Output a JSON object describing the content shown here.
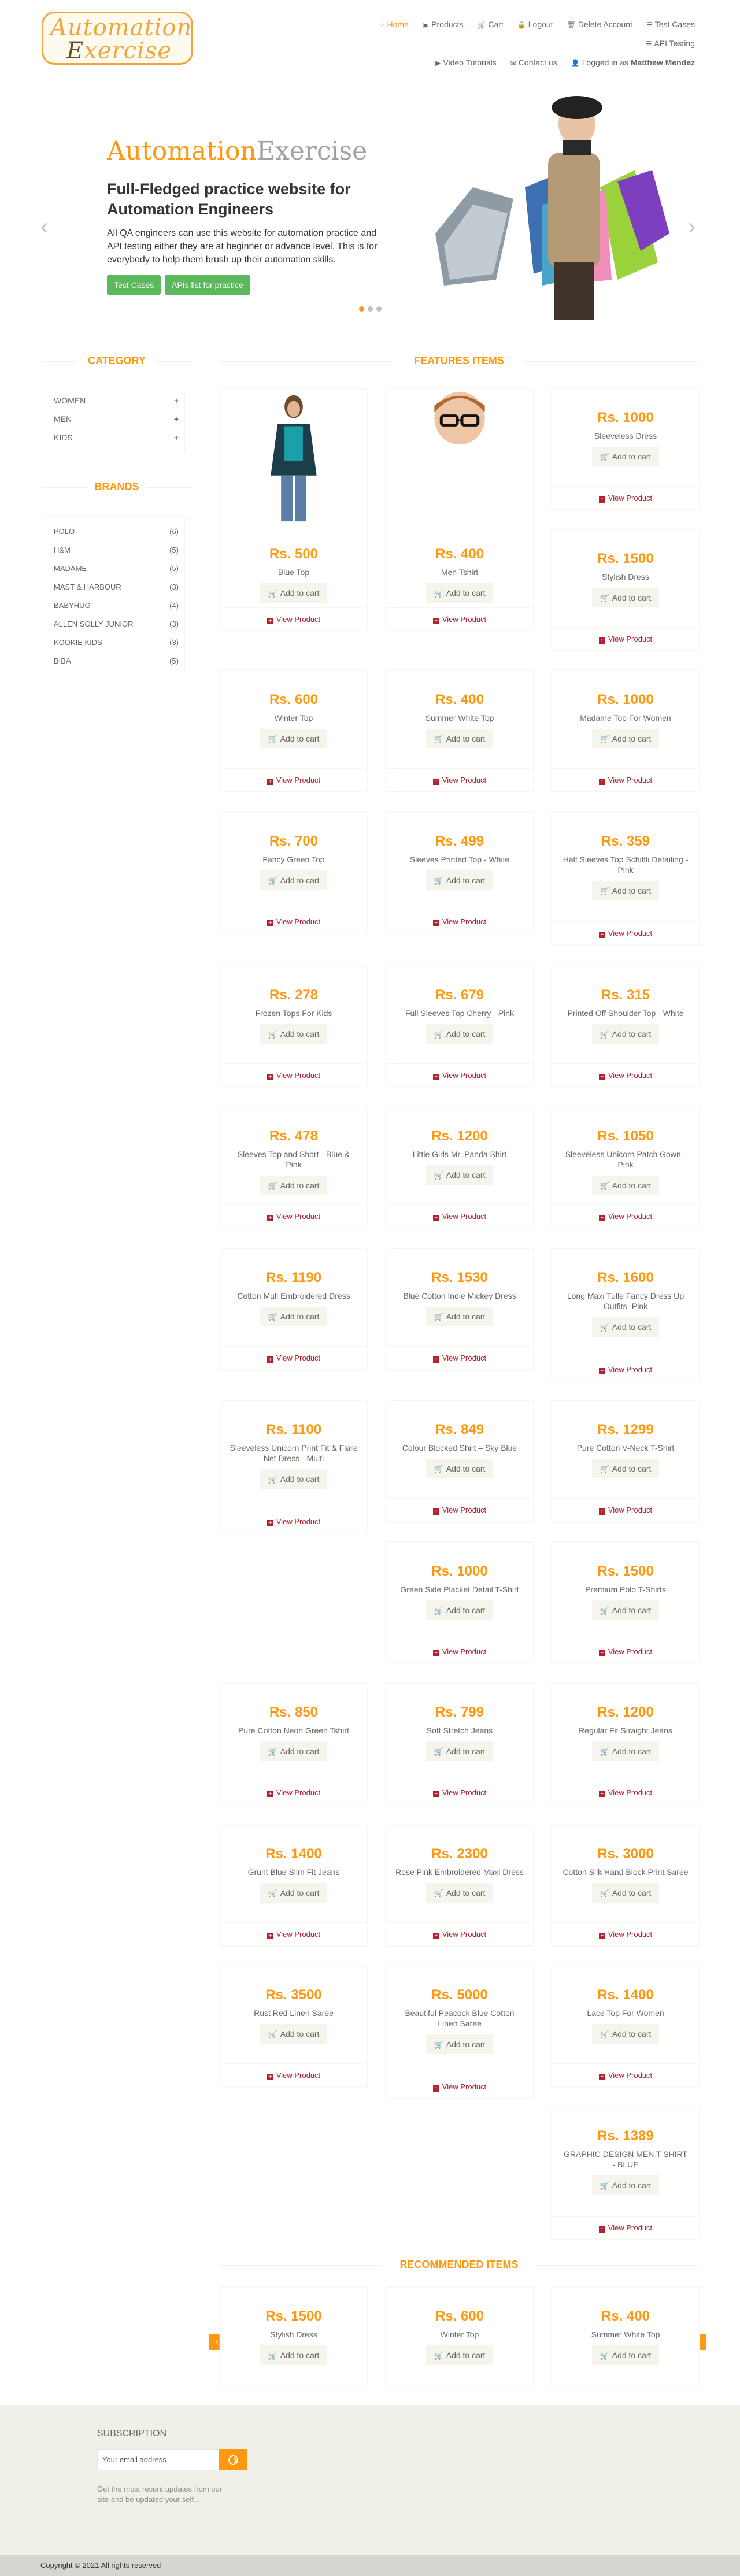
{
  "header": {
    "logo": {
      "word1": "Automation",
      "word2_first": "E",
      "word2_rest": "xercise"
    },
    "nav": [
      {
        "icon": "⌂",
        "label": "Home",
        "active": true
      },
      {
        "icon": "▣",
        "label": "Products"
      },
      {
        "icon": "🛒",
        "label": "Cart"
      },
      {
        "icon": "🔒",
        "label": "Logout"
      },
      {
        "icon": "🗑",
        "label": "Delete Account"
      },
      {
        "icon": "☰",
        "label": "Test Cases"
      },
      {
        "icon": "☰",
        "label": "API Testing"
      },
      {
        "icon": "▶",
        "label": "Video Tutorials"
      },
      {
        "icon": "✉",
        "label": "Contact us"
      },
      {
        "icon": "👤",
        "label": "Logged in as ",
        "user": "Matthew Mendez"
      }
    ]
  },
  "slider": {
    "title_a": "Automation",
    "title_b": "Exercise",
    "subtitle": "Full-Fledged practice website for Automation Engineers",
    "description": "All QA engineers can use this website for automation practice and API testing either they are at beginner or advance level. This is for everybody to help them brush up their automation skills.",
    "btn_test_cases": "Test Cases",
    "btn_apis": "APIs list for practice",
    "prev": "‹",
    "next": "›"
  },
  "sidebar": {
    "category_title": "CATEGORY",
    "categories": [
      {
        "label": "WOMEN",
        "icon": "+"
      },
      {
        "label": "MEN",
        "icon": "+"
      },
      {
        "label": "KIDS",
        "icon": "+"
      }
    ],
    "brands_title": "BRANDS",
    "brands": [
      {
        "label": "POLO",
        "count": "(6)"
      },
      {
        "label": "H&M",
        "count": "(5)"
      },
      {
        "label": "MADAME",
        "count": "(5)"
      },
      {
        "label": "MAST & HARBOUR",
        "count": "(3)"
      },
      {
        "label": "BABYHUG",
        "count": "(4)"
      },
      {
        "label": "ALLEN SOLLY JUNIOR",
        "count": "(3)"
      },
      {
        "label": "KOOKIE KIDS",
        "count": "(3)"
      },
      {
        "label": "BIBA",
        "count": "(5)"
      }
    ]
  },
  "features": {
    "title": "FEATURES ITEMS",
    "add_label": "Add to cart",
    "view_label": "View Product",
    "products": [
      {
        "price": "Rs. 500",
        "name": "Blue Top"
      },
      {
        "price": "Rs. 400",
        "name": "Men Tshirt"
      },
      {
        "price": "Rs. 1000",
        "name": "Sleeveless Dress"
      },
      {
        "price": "Rs. 1500",
        "name": "Stylish Dress"
      },
      {
        "price": "Rs. 600",
        "name": "Winter Top"
      },
      {
        "price": "Rs. 400",
        "name": "Summer White Top"
      },
      {
        "price": "Rs. 1000",
        "name": "Madame Top For Women"
      },
      {
        "price": "Rs. 700",
        "name": "Fancy Green Top"
      },
      {
        "price": "Rs. 499",
        "name": "Sleeves Printed Top - White"
      },
      {
        "price": "Rs. 359",
        "name": "Half Sleeves Top Schiffli Detailing - Pink"
      },
      {
        "price": "Rs. 278",
        "name": "Frozen Tops For Kids"
      },
      {
        "price": "Rs. 679",
        "name": "Full Sleeves Top Cherry - Pink"
      },
      {
        "price": "Rs. 315",
        "name": "Printed Off Shoulder Top - White"
      },
      {
        "price": "Rs. 478",
        "name": "Sleeves Top and Short - Blue & Pink"
      },
      {
        "price": "Rs. 1200",
        "name": "Little Girls Mr. Panda Shirt"
      },
      {
        "price": "Rs. 1050",
        "name": "Sleeveless Unicorn Patch Gown - Pink"
      },
      {
        "price": "Rs. 1190",
        "name": "Cotton Mull Embroidered Dress"
      },
      {
        "price": "Rs. 1530",
        "name": "Blue Cotton Indie Mickey Dress"
      },
      {
        "price": "Rs. 1600",
        "name": "Long Maxi Tulle Fancy Dress Up Outfits -Pink"
      },
      {
        "price": "Rs. 1100",
        "name": "Sleeveless Unicorn Print Fit & Flare Net Dress - Multi"
      },
      {
        "price": "Rs. 849",
        "name": "Colour Blocked Shirt – Sky Blue"
      },
      {
        "price": "Rs. 1299",
        "name": "Pure Cotton V-Neck T-Shirt"
      },
      {
        "price": "Rs. 1000",
        "name": "Green Side Placket Detail T-Shirt"
      },
      {
        "price": "Rs. 1500",
        "name": "Premium Polo T-Shirts"
      },
      {
        "price": "Rs. 850",
        "name": "Pure Cotton Neon Green Tshirt"
      },
      {
        "price": "Rs. 799",
        "name": "Soft Stretch Jeans"
      },
      {
        "price": "Rs. 1200",
        "name": "Regular Fit Straight Jeans"
      },
      {
        "price": "Rs. 1400",
        "name": "Grunt Blue Slim Fit Jeans"
      },
      {
        "price": "Rs. 2300",
        "name": "Rose Pink Embroidered Maxi Dress"
      },
      {
        "price": "Rs. 3000",
        "name": "Cotton Silk Hand Block Print Saree"
      },
      {
        "price": "Rs. 3500",
        "name": "Rust Red Linen Saree"
      },
      {
        "price": "Rs. 5000",
        "name": "Beautiful Peacock Blue Cotton Linen Saree"
      },
      {
        "price": "Rs. 1400",
        "name": "Lace Top For Women"
      },
      {
        "price": "Rs. 1389",
        "name": "GRAPHIC DESIGN MEN T SHIRT - BLUE"
      }
    ]
  },
  "recommended": {
    "title": "RECOMMENDED ITEMS",
    "prev": "‹",
    "next": "›",
    "items": [
      {
        "price": "Rs. 1500",
        "name": "Stylish Dress"
      },
      {
        "price": "Rs. 600",
        "name": "Winter Top"
      },
      {
        "price": "Rs. 400",
        "name": "Summer White Top"
      }
    ]
  },
  "footer": {
    "subscription_title": "SUBSCRIPTION",
    "email_placeholder": "Your email address",
    "subscription_text": "Get the most recent updates from our site and be updated your self...",
    "copyright": "Copyright © 2021 All rights reserved"
  },
  "colors": {
    "accent": "#fe980f",
    "green": "#5cb85c",
    "view_red": "#b3222e"
  }
}
